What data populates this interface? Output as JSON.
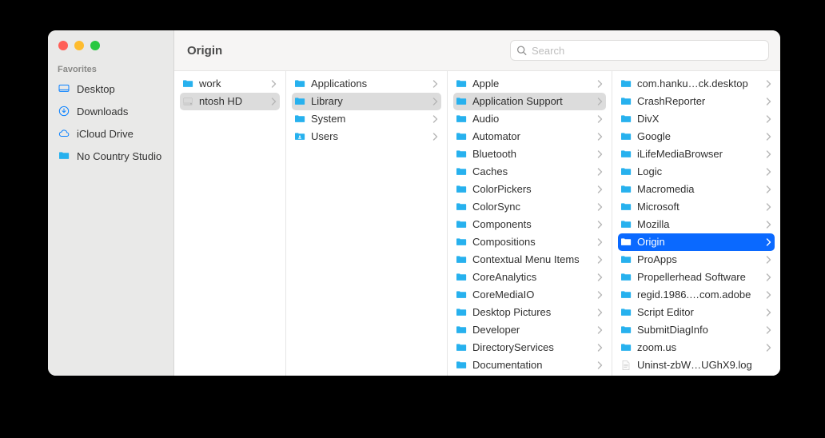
{
  "title": "Origin",
  "search_placeholder": "Search",
  "sidebar": {
    "section_label": "Favorites",
    "items": [
      {
        "label": "Desktop",
        "icon": "desktop"
      },
      {
        "label": "Downloads",
        "icon": "download"
      },
      {
        "label": "iCloud Drive",
        "icon": "cloud"
      },
      {
        "label": "No Country Studio",
        "icon": "folder-blue"
      }
    ]
  },
  "columns": {
    "col0": [
      {
        "label": "work",
        "type": "folder",
        "arrow": true,
        "selected": false,
        "truncated_left": true
      },
      {
        "label": "ntosh HD",
        "type": "disk",
        "arrow": true,
        "selected": "gray",
        "truncated_left": true
      }
    ],
    "col1": [
      {
        "label": "Applications",
        "type": "folder",
        "arrow": true,
        "selected": false
      },
      {
        "label": "Library",
        "type": "folder",
        "arrow": true,
        "selected": "gray"
      },
      {
        "label": "System",
        "type": "folder",
        "arrow": true,
        "selected": false
      },
      {
        "label": "Users",
        "type": "users",
        "arrow": true,
        "selected": false
      }
    ],
    "col2": [
      {
        "label": "Apple",
        "type": "folder",
        "arrow": true,
        "selected": false
      },
      {
        "label": "Application Support",
        "type": "folder",
        "arrow": true,
        "selected": "gray"
      },
      {
        "label": "Audio",
        "type": "folder",
        "arrow": true,
        "selected": false
      },
      {
        "label": "Automator",
        "type": "folder",
        "arrow": true,
        "selected": false
      },
      {
        "label": "Bluetooth",
        "type": "folder",
        "arrow": true,
        "selected": false
      },
      {
        "label": "Caches",
        "type": "folder",
        "arrow": true,
        "selected": false
      },
      {
        "label": "ColorPickers",
        "type": "folder",
        "arrow": true,
        "selected": false
      },
      {
        "label": "ColorSync",
        "type": "folder",
        "arrow": true,
        "selected": false
      },
      {
        "label": "Components",
        "type": "folder",
        "arrow": true,
        "selected": false
      },
      {
        "label": "Compositions",
        "type": "folder",
        "arrow": true,
        "selected": false
      },
      {
        "label": "Contextual Menu Items",
        "type": "folder",
        "arrow": true,
        "selected": false
      },
      {
        "label": "CoreAnalytics",
        "type": "folder",
        "arrow": true,
        "selected": false
      },
      {
        "label": "CoreMediaIO",
        "type": "folder",
        "arrow": true,
        "selected": false
      },
      {
        "label": "Desktop Pictures",
        "type": "folder",
        "arrow": true,
        "selected": false
      },
      {
        "label": "Developer",
        "type": "folder",
        "arrow": true,
        "selected": false
      },
      {
        "label": "DirectoryServices",
        "type": "folder",
        "arrow": true,
        "selected": false
      },
      {
        "label": "Documentation",
        "type": "folder",
        "arrow": true,
        "selected": false
      }
    ],
    "col3": [
      {
        "label": "com.hanku…ck.desktop",
        "type": "folder",
        "arrow": true,
        "selected": false
      },
      {
        "label": "CrashReporter",
        "type": "folder",
        "arrow": true,
        "selected": false
      },
      {
        "label": "DivX",
        "type": "folder",
        "arrow": true,
        "selected": false
      },
      {
        "label": "Google",
        "type": "folder",
        "arrow": true,
        "selected": false
      },
      {
        "label": "iLifeMediaBrowser",
        "type": "folder",
        "arrow": true,
        "selected": false
      },
      {
        "label": "Logic",
        "type": "folder",
        "arrow": true,
        "selected": false
      },
      {
        "label": "Macromedia",
        "type": "folder",
        "arrow": true,
        "selected": false
      },
      {
        "label": "Microsoft",
        "type": "folder",
        "arrow": true,
        "selected": false
      },
      {
        "label": "Mozilla",
        "type": "folder",
        "arrow": true,
        "selected": false
      },
      {
        "label": "Origin",
        "type": "folder",
        "arrow": true,
        "selected": "blue"
      },
      {
        "label": "ProApps",
        "type": "folder",
        "arrow": true,
        "selected": false
      },
      {
        "label": "Propellerhead Software",
        "type": "folder",
        "arrow": true,
        "selected": false
      },
      {
        "label": "regid.1986.…com.adobe",
        "type": "folder",
        "arrow": true,
        "selected": false
      },
      {
        "label": "Script Editor",
        "type": "folder",
        "arrow": true,
        "selected": false
      },
      {
        "label": "SubmitDiagInfo",
        "type": "folder",
        "arrow": true,
        "selected": false
      },
      {
        "label": "zoom.us",
        "type": "folder",
        "arrow": true,
        "selected": false
      },
      {
        "label": "Uninst-zbW…UGhX9.log",
        "type": "file",
        "arrow": false,
        "selected": false
      }
    ]
  }
}
